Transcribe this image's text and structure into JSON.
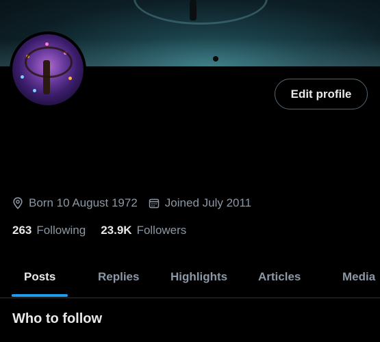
{
  "profile": {
    "edit_button": "Edit profile",
    "born": "Born 10 August 1972",
    "joined": "Joined July 2011",
    "following_count": "263",
    "following_label": "Following",
    "followers_count": "23.9K",
    "followers_label": "Followers"
  },
  "tabs": [
    {
      "label": "Posts",
      "active": true
    },
    {
      "label": "Replies"
    },
    {
      "label": "Highlights"
    },
    {
      "label": "Articles"
    },
    {
      "label": "Media"
    }
  ],
  "sections": {
    "who_to_follow": "Who to follow"
  },
  "colors": {
    "background": "#000000",
    "text": "#e7e9ea",
    "secondary_text": "#8b98a5",
    "accent": "#1d9bf0",
    "border": "#2f3336"
  },
  "icons": {
    "born": "location-pin-icon",
    "joined": "calendar-icon"
  }
}
